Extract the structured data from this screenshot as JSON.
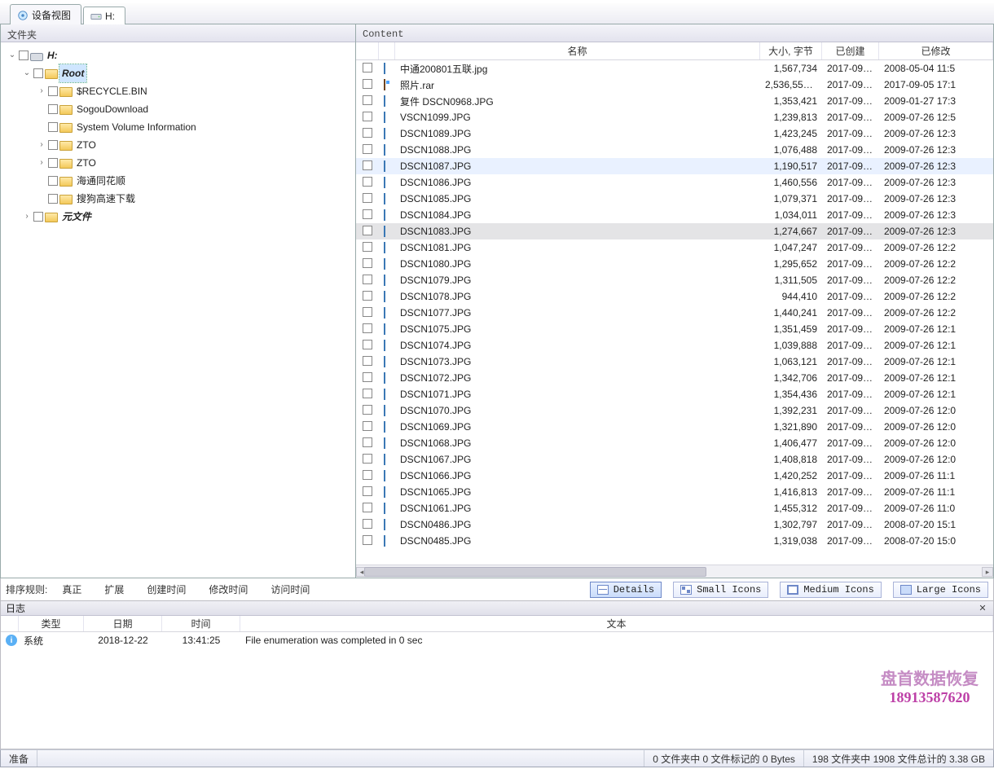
{
  "tabs": {
    "device_view": "设备视图",
    "drive": "H:"
  },
  "panes": {
    "folders_title": "文件夹",
    "content_title": "Content"
  },
  "tree": {
    "root_drive": "H:",
    "root_folder": "Root",
    "items": [
      "$RECYCLE.BIN",
      "SogouDownload",
      "System Volume Information",
      "ZTO",
      "ZTO",
      "海通同花顺",
      "搜狗高速下载"
    ],
    "meta_folder": "元文件"
  },
  "columns": {
    "name": "名称",
    "size": "大小, 字节",
    "created": "已创建",
    "modified": "已修改"
  },
  "files": [
    {
      "name": "中通200801五联.jpg",
      "size": "1,567,734",
      "created": "2017-09-...",
      "modified": "2008-05-04 11:5",
      "type": "pic"
    },
    {
      "name": "照片.rar",
      "size": "2,536,550,...",
      "created": "2017-09-...",
      "modified": "2017-09-05 17:1",
      "type": "rar"
    },
    {
      "name": "复件 DSCN0968.JPG",
      "size": "1,353,421",
      "created": "2017-09-...",
      "modified": "2009-01-27 17:3",
      "type": "pic"
    },
    {
      "name": "VSCN1099.JPG",
      "size": "1,239,813",
      "created": "2017-09-...",
      "modified": "2009-07-26 12:5",
      "type": "pic"
    },
    {
      "name": "DSCN1089.JPG",
      "size": "1,423,245",
      "created": "2017-09-...",
      "modified": "2009-07-26 12:3",
      "type": "pic"
    },
    {
      "name": "DSCN1088.JPG",
      "size": "1,076,488",
      "created": "2017-09-...",
      "modified": "2009-07-26 12:3",
      "type": "pic"
    },
    {
      "name": "DSCN1087.JPG",
      "size": "1,190,517",
      "created": "2017-09-...",
      "modified": "2009-07-26 12:3",
      "type": "pic",
      "hl": true
    },
    {
      "name": "DSCN1086.JPG",
      "size": "1,460,556",
      "created": "2017-09-...",
      "modified": "2009-07-26 12:3",
      "type": "pic"
    },
    {
      "name": "DSCN1085.JPG",
      "size": "1,079,371",
      "created": "2017-09-...",
      "modified": "2009-07-26 12:3",
      "type": "pic"
    },
    {
      "name": "DSCN1084.JPG",
      "size": "1,034,011",
      "created": "2017-09-...",
      "modified": "2009-07-26 12:3",
      "type": "pic"
    },
    {
      "name": "DSCN1083.JPG",
      "size": "1,274,667",
      "created": "2017-09-...",
      "modified": "2009-07-26 12:3",
      "type": "pic",
      "sel": true
    },
    {
      "name": "DSCN1081.JPG",
      "size": "1,047,247",
      "created": "2017-09-...",
      "modified": "2009-07-26 12:2",
      "type": "pic"
    },
    {
      "name": "DSCN1080.JPG",
      "size": "1,295,652",
      "created": "2017-09-...",
      "modified": "2009-07-26 12:2",
      "type": "pic"
    },
    {
      "name": "DSCN1079.JPG",
      "size": "1,311,505",
      "created": "2017-09-...",
      "modified": "2009-07-26 12:2",
      "type": "pic"
    },
    {
      "name": "DSCN1078.JPG",
      "size": "944,410",
      "created": "2017-09-...",
      "modified": "2009-07-26 12:2",
      "type": "pic"
    },
    {
      "name": "DSCN1077.JPG",
      "size": "1,440,241",
      "created": "2017-09-...",
      "modified": "2009-07-26 12:2",
      "type": "pic"
    },
    {
      "name": "DSCN1075.JPG",
      "size": "1,351,459",
      "created": "2017-09-...",
      "modified": "2009-07-26 12:1",
      "type": "pic"
    },
    {
      "name": "DSCN1074.JPG",
      "size": "1,039,888",
      "created": "2017-09-...",
      "modified": "2009-07-26 12:1",
      "type": "pic"
    },
    {
      "name": "DSCN1073.JPG",
      "size": "1,063,121",
      "created": "2017-09-...",
      "modified": "2009-07-26 12:1",
      "type": "pic"
    },
    {
      "name": "DSCN1072.JPG",
      "size": "1,342,706",
      "created": "2017-09-...",
      "modified": "2009-07-26 12:1",
      "type": "pic"
    },
    {
      "name": "DSCN1071.JPG",
      "size": "1,354,436",
      "created": "2017-09-...",
      "modified": "2009-07-26 12:1",
      "type": "pic"
    },
    {
      "name": "DSCN1070.JPG",
      "size": "1,392,231",
      "created": "2017-09-...",
      "modified": "2009-07-26 12:0",
      "type": "pic"
    },
    {
      "name": "DSCN1069.JPG",
      "size": "1,321,890",
      "created": "2017-09-...",
      "modified": "2009-07-26 12:0",
      "type": "pic"
    },
    {
      "name": "DSCN1068.JPG",
      "size": "1,406,477",
      "created": "2017-09-...",
      "modified": "2009-07-26 12:0",
      "type": "pic"
    },
    {
      "name": "DSCN1067.JPG",
      "size": "1,408,818",
      "created": "2017-09-...",
      "modified": "2009-07-26 12:0",
      "type": "pic"
    },
    {
      "name": "DSCN1066.JPG",
      "size": "1,420,252",
      "created": "2017-09-...",
      "modified": "2009-07-26 11:1",
      "type": "pic"
    },
    {
      "name": "DSCN1065.JPG",
      "size": "1,416,813",
      "created": "2017-09-...",
      "modified": "2009-07-26 11:1",
      "type": "pic"
    },
    {
      "name": "DSCN1061.JPG",
      "size": "1,455,312",
      "created": "2017-09-...",
      "modified": "2009-07-26 11:0",
      "type": "pic"
    },
    {
      "name": "DSCN0486.JPG",
      "size": "1,302,797",
      "created": "2017-09-...",
      "modified": "2008-07-20 15:1",
      "type": "pic"
    },
    {
      "name": "DSCN0485.JPG",
      "size": "1,319,038",
      "created": "2017-09-...",
      "modified": "2008-07-20 15:0",
      "type": "pic"
    }
  ],
  "toolbar": {
    "sort_label": "排序规则:",
    "buttons": [
      "真正",
      "扩展",
      "创建时间",
      "修改时间",
      "访问时间"
    ],
    "views": {
      "details": "Details",
      "small": "Small Icons",
      "medium": "Medium Icons",
      "large": "Large Icons"
    }
  },
  "log": {
    "title": "日志",
    "cols": {
      "type": "类型",
      "date": "日期",
      "time": "时间",
      "text": "文本"
    },
    "rows": [
      {
        "type": "系统",
        "date": "2018-12-22",
        "time": "13:41:25",
        "text": "File enumeration was completed in 0 sec"
      }
    ]
  },
  "watermark": {
    "line1": "盘首数据恢复",
    "line2": "18913587620"
  },
  "status": {
    "ready": "准备",
    "marked": "0 文件夹中 0 文件标记的 0 Bytes",
    "total": "198 文件夹中 1908 文件总计的 3.38 GB"
  }
}
